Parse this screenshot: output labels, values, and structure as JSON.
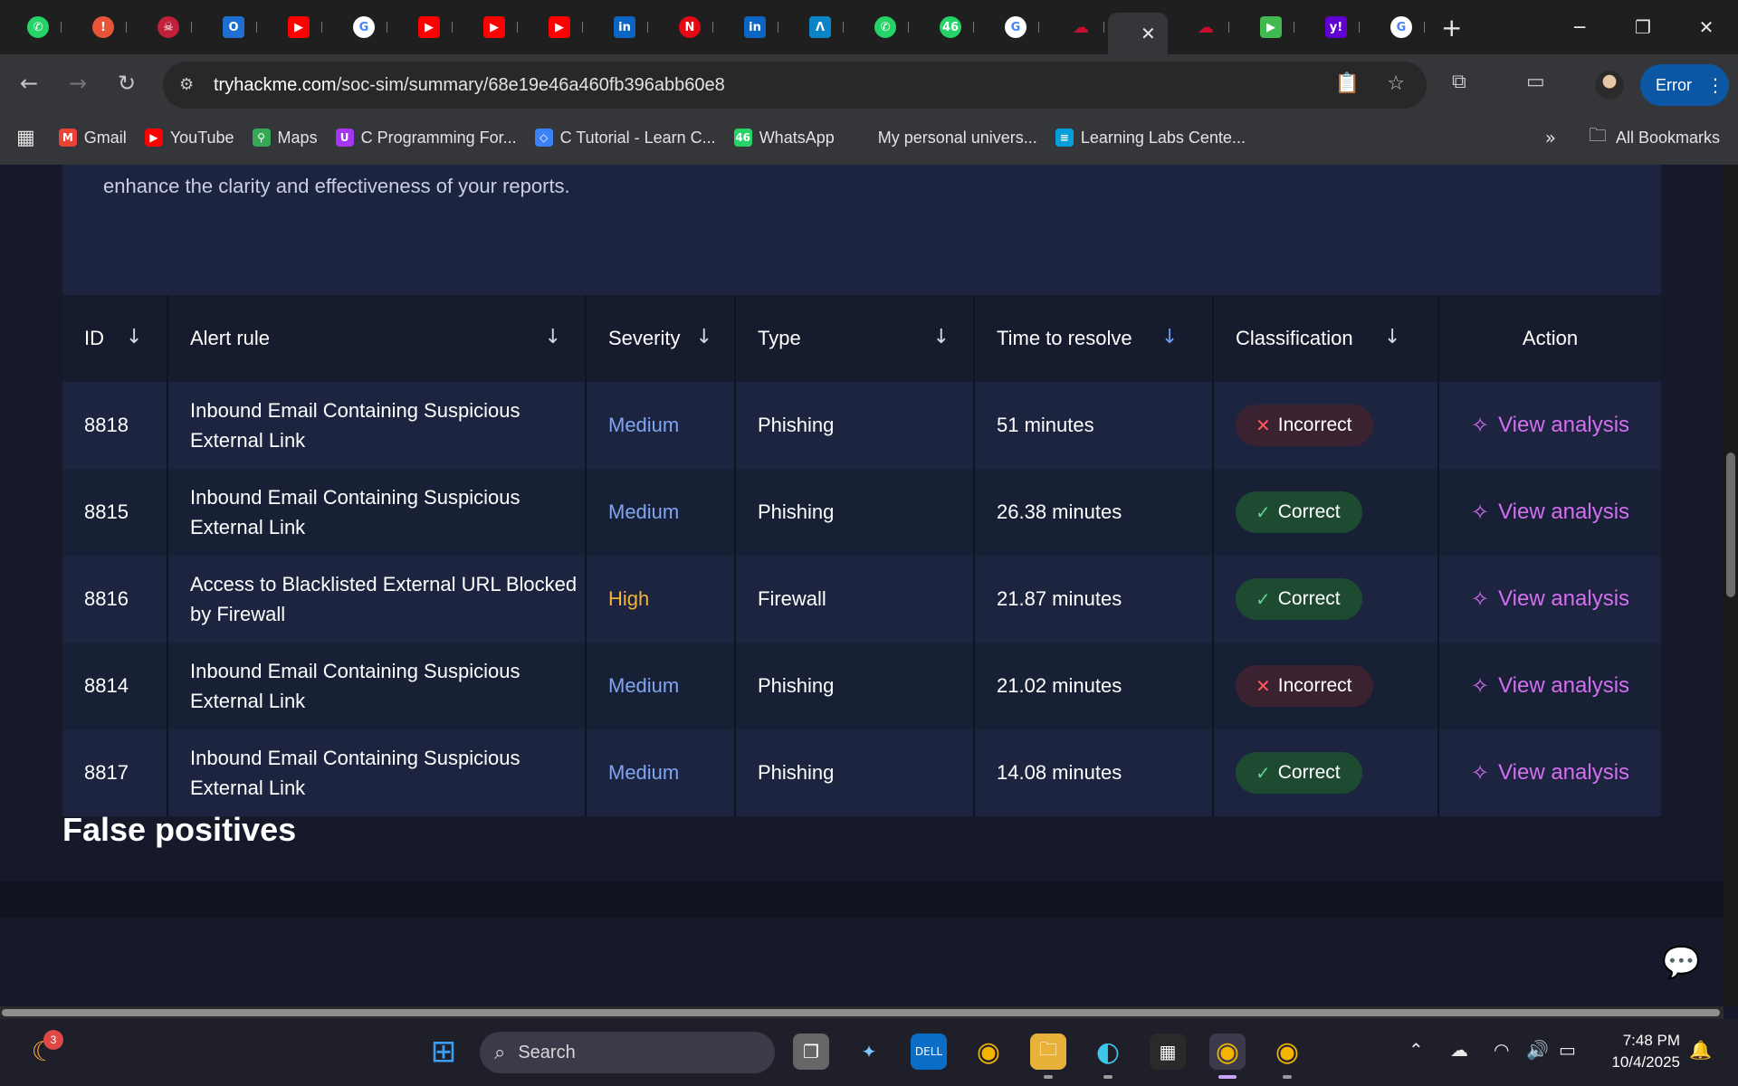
{
  "browser": {
    "tabs": [
      {
        "icon": "whatsapp-icon",
        "color": "#25d366",
        "glyph": "✆"
      },
      {
        "icon": "alert-icon",
        "color": "#e8543a",
        "glyph": "!"
      },
      {
        "icon": "hacker-icon",
        "color": "#c0203a",
        "glyph": "☠"
      },
      {
        "icon": "outlook-icon",
        "color": "#1f6fd0",
        "glyph": "O"
      },
      {
        "icon": "youtube-icon",
        "color": "#ff0000",
        "glyph": "▶"
      },
      {
        "icon": "google-icon",
        "color": "#ffffff",
        "glyph": "G"
      },
      {
        "icon": "youtube-icon",
        "color": "#ff0000",
        "glyph": "▶"
      },
      {
        "icon": "youtube-icon",
        "color": "#ff0000",
        "glyph": "▶"
      },
      {
        "icon": "youtube-icon",
        "color": "#ff0000",
        "glyph": "▶"
      },
      {
        "icon": "linkedin-icon",
        "color": "#0a66c2",
        "glyph": "in"
      },
      {
        "icon": "netflix-icon",
        "color": "#e50914",
        "glyph": "N"
      },
      {
        "icon": "linkedin-icon",
        "color": "#0a66c2",
        "glyph": "in"
      },
      {
        "icon": "app-a-icon",
        "color": "#0a84c6",
        "glyph": "Λ"
      },
      {
        "icon": "whatsapp-icon",
        "color": "#25d366",
        "glyph": "✆"
      },
      {
        "icon": "whatsapp-46-icon",
        "color": "#25d366",
        "glyph": "46"
      },
      {
        "icon": "google-icon",
        "color": "#ffffff",
        "glyph": "G"
      },
      {
        "icon": "tryhackme-icon",
        "color": "#c8102e",
        "glyph": "☁"
      }
    ],
    "tabs_after": [
      {
        "icon": "tryhackme-icon",
        "color": "#c8102e",
        "glyph": "☁"
      },
      {
        "icon": "terminal-icon",
        "color": "#3fb950",
        "glyph": "▶"
      },
      {
        "icon": "yahoo-icon",
        "color": "#6001d2",
        "glyph": "y!"
      },
      {
        "icon": "google-icon",
        "color": "#ffffff",
        "glyph": "G"
      }
    ],
    "url_host": "tryhackme.com",
    "url_path": "/soc-sim/summary/68e19e46a460fb396abb60e8",
    "profile_button": "Error",
    "bookmarks": [
      {
        "label": "Gmail",
        "icon": "gmail-icon",
        "color": "#ea4335",
        "glyph": "M"
      },
      {
        "label": "YouTube",
        "icon": "youtube-icon",
        "color": "#ff0000",
        "glyph": "▶"
      },
      {
        "label": "Maps",
        "icon": "maps-icon",
        "color": "#34a853",
        "glyph": "⚲"
      },
      {
        "label": "C Programming For...",
        "icon": "udemy-icon",
        "color": "#a435f0",
        "glyph": "U"
      },
      {
        "label": "C Tutorial - Learn C...",
        "icon": "programiz-icon",
        "color": "#3b82f6",
        "glyph": "◇"
      },
      {
        "label": "WhatsApp",
        "icon": "whatsapp-icon",
        "color": "#25d366",
        "glyph": "46"
      },
      {
        "label": "My personal univers...",
        "icon": "blank-icon",
        "color": "#35363a",
        "glyph": ""
      },
      {
        "label": "Learning Labs Cente...",
        "icon": "cisco-icon",
        "color": "#049fd9",
        "glyph": "≡"
      }
    ],
    "all_bookmarks": "All Bookmarks"
  },
  "page": {
    "feedback_text": "aspects. Additionally, while the \"What\" and \"Why\" are generally well-covered, make sure to consistently include the \"When\" to provide a complete timeline of events. This will enhance the clarity and effectiveness of your reports.",
    "table": {
      "headers": {
        "id": "ID",
        "rule": "Alert rule",
        "severity": "Severity",
        "type": "Type",
        "time": "Time to resolve",
        "classification": "Classification",
        "action": "Action"
      },
      "rows": [
        {
          "id": "8818",
          "rule": "Inbound Email Containing Suspicious External Link",
          "severity": "Medium",
          "type": "Phishing",
          "time": "51 minutes",
          "classification": "Incorrect",
          "action": "View analysis"
        },
        {
          "id": "8815",
          "rule": "Inbound Email Containing Suspicious External Link",
          "severity": "Medium",
          "type": "Phishing",
          "time": "26.38 minutes",
          "classification": "Correct",
          "action": "View analysis"
        },
        {
          "id": "8816",
          "rule": "Access to Blacklisted External URL Blocked by Firewall",
          "severity": "High",
          "type": "Firewall",
          "time": "21.87 minutes",
          "classification": "Correct",
          "action": "View analysis"
        },
        {
          "id": "8814",
          "rule": "Inbound Email Containing Suspicious External Link",
          "severity": "Medium",
          "type": "Phishing",
          "time": "21.02 minutes",
          "classification": "Incorrect",
          "action": "View analysis"
        },
        {
          "id": "8817",
          "rule": "Inbound Email Containing Suspicious External Link",
          "severity": "Medium",
          "type": "Phishing",
          "time": "14.08 minutes",
          "classification": "Correct",
          "action": "View analysis"
        }
      ]
    },
    "section_title": "False positives",
    "colors": {
      "medium": "#7ea6f2",
      "high": "#f2b43c",
      "action": "#d46ef0",
      "correct_bg": "#1f4a32",
      "incorrect_bg": "#3b2230"
    }
  },
  "taskbar": {
    "search_placeholder": "Search",
    "weather_badge": "3",
    "time": "7:48 PM",
    "date": "10/4/2025"
  }
}
